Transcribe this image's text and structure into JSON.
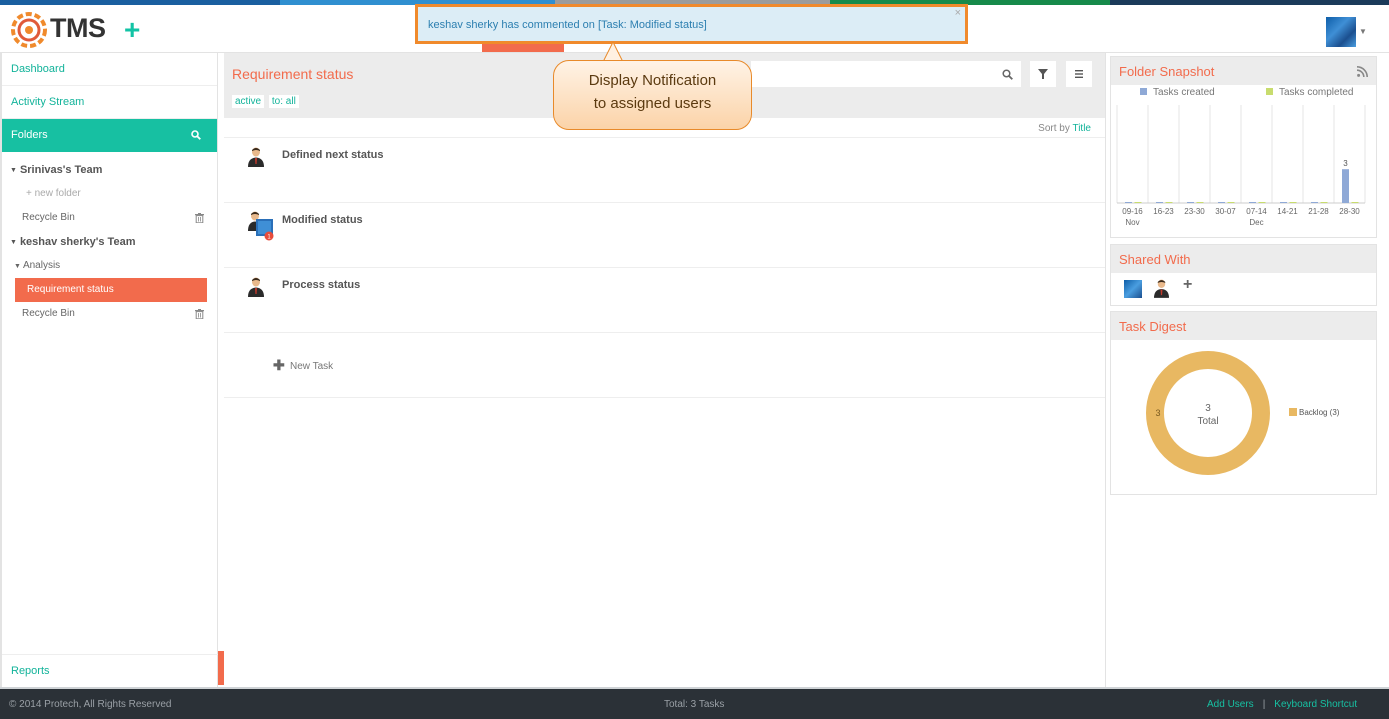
{
  "app": {
    "logo_text": "TMS"
  },
  "notification": {
    "text": "keshav sherky has commented on [Task: Modified status]",
    "close": "×"
  },
  "callout": {
    "line1": "Display Notification",
    "line2": "to assigned users"
  },
  "sidebar": {
    "dashboard": "Dashboard",
    "activity_stream": "Activity Stream",
    "folders": "Folders",
    "team1": "Srinivas's Team",
    "new_folder": "+ new folder",
    "recycle_bin_1": "Recycle Bin",
    "team2": "keshav sherky's Team",
    "analysis": "Analysis",
    "active_folder": "Requirement status",
    "recycle_bin_2": "Recycle Bin",
    "reports": "Reports"
  },
  "main": {
    "title": "Requirement status",
    "filter_active": "active",
    "filter_to": "to: all",
    "sort_label": "Sort by",
    "sort_value": "Title",
    "tasks": [
      {
        "title": "Defined next status"
      },
      {
        "title": "Modified status",
        "badge": "1"
      },
      {
        "title": "Process status"
      }
    ],
    "new_task": "New Task"
  },
  "snapshot": {
    "title": "Folder Snapshot",
    "legend_created": "Tasks created",
    "legend_completed": "Tasks completed",
    "colors": {
      "created": "#8fa9d6",
      "completed": "#c8dc6e"
    }
  },
  "chart_data": [
    {
      "type": "bar",
      "categories": [
        "09-16",
        "16-23",
        "23-30",
        "30-07",
        "07-14",
        "14-21",
        "21-28",
        "28-30"
      ],
      "month_labels": {
        "Nov": "09-16",
        "Dec": "07-14"
      },
      "series": [
        {
          "name": "Tasks created",
          "values": [
            0,
            0,
            0,
            0,
            0,
            0,
            0,
            3
          ]
        },
        {
          "name": "Tasks completed",
          "values": [
            0,
            0,
            0,
            0,
            0,
            0,
            0,
            0
          ]
        }
      ],
      "data_labels": [
        "3"
      ],
      "month_nov": "Nov",
      "month_dec": "Dec",
      "ylim": [
        0,
        10
      ],
      "grid": true
    },
    {
      "type": "pie",
      "categories": [
        "Backlog"
      ],
      "values": [
        3
      ],
      "center_value": "3",
      "center_label": "Total",
      "slice_label": "3",
      "legend": [
        "Backlog (3)"
      ],
      "colors": [
        "#e8b862"
      ]
    }
  ],
  "shared": {
    "title": "Shared With",
    "add": "+"
  },
  "digest": {
    "title": "Task Digest"
  },
  "footer": {
    "copyright": "© 2014 Protech, All Rights Reserved",
    "total": "Total: 3 Tasks",
    "add_users": "Add Users",
    "separator": "|",
    "keyboard": "Keyboard Shortcut"
  }
}
